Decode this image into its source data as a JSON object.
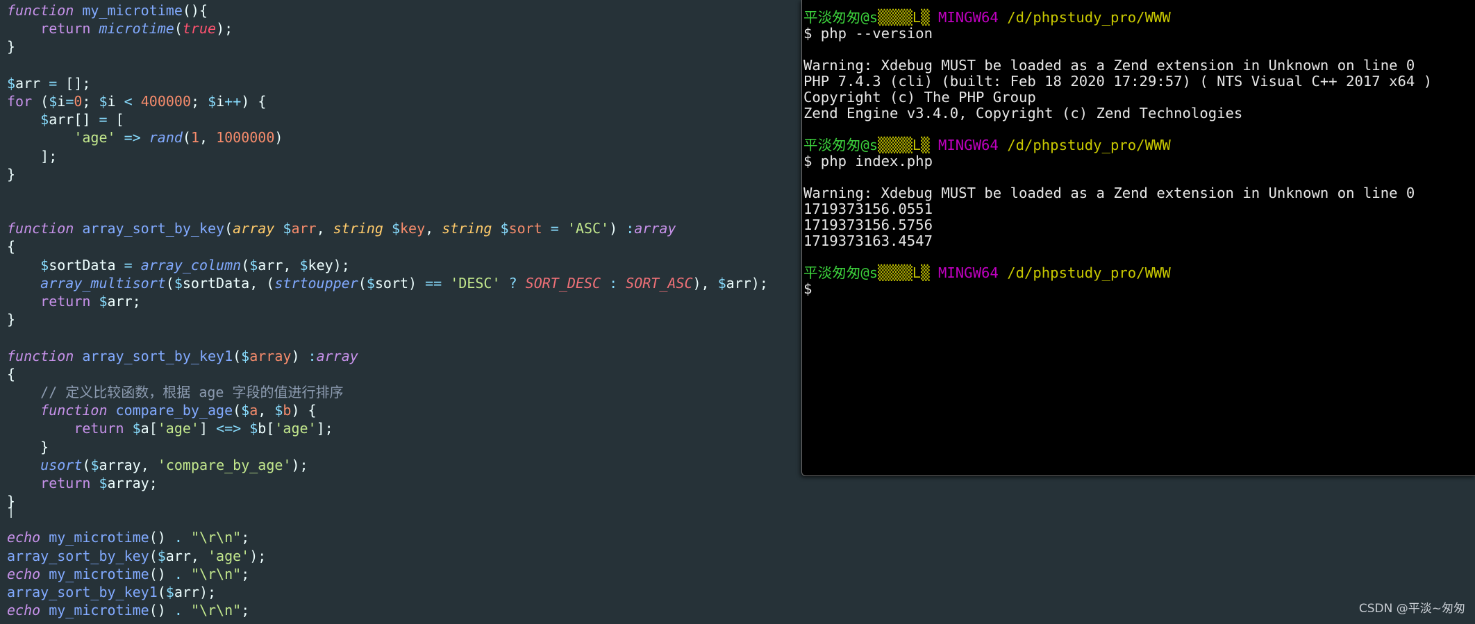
{
  "editor": {
    "lines": [
      [
        [
          "kw",
          "function"
        ],
        [
          "punct",
          " "
        ],
        [
          "fn",
          "my_microtime"
        ],
        [
          "punct",
          "(){"
        ]
      ],
      [
        [
          "punct",
          "    "
        ],
        [
          "kw-plain",
          "return"
        ],
        [
          "punct",
          " "
        ],
        [
          "fn-call",
          "microtime"
        ],
        [
          "punct",
          "("
        ],
        [
          "bool",
          "true"
        ],
        [
          "punct",
          ");"
        ]
      ],
      [
        [
          "punct",
          "}"
        ]
      ],
      [
        [
          "punct",
          ""
        ]
      ],
      [
        [
          "dollar",
          "$"
        ],
        [
          "var",
          "arr"
        ],
        [
          "punct",
          " "
        ],
        [
          "op",
          "="
        ],
        [
          "punct",
          " [];"
        ]
      ],
      [
        [
          "kw-plain",
          "for"
        ],
        [
          "punct",
          " ("
        ],
        [
          "dollar",
          "$"
        ],
        [
          "var",
          "i"
        ],
        [
          "op",
          "="
        ],
        [
          "num",
          "0"
        ],
        [
          "punct",
          "; "
        ],
        [
          "dollar",
          "$"
        ],
        [
          "var",
          "i"
        ],
        [
          "punct",
          " "
        ],
        [
          "op",
          "<"
        ],
        [
          "punct",
          " "
        ],
        [
          "num",
          "400000"
        ],
        [
          "punct",
          "; "
        ],
        [
          "dollar",
          "$"
        ],
        [
          "var",
          "i"
        ],
        [
          "op",
          "++"
        ],
        [
          "punct",
          ") {"
        ]
      ],
      [
        [
          "punct",
          "    "
        ],
        [
          "dollar",
          "$"
        ],
        [
          "var",
          "arr"
        ],
        [
          "punct",
          "[] "
        ],
        [
          "op",
          "="
        ],
        [
          "punct",
          " ["
        ]
      ],
      [
        [
          "punct",
          "        "
        ],
        [
          "str",
          "'age'"
        ],
        [
          "punct",
          " "
        ],
        [
          "op",
          "=>"
        ],
        [
          "punct",
          " "
        ],
        [
          "fn-call",
          "rand"
        ],
        [
          "punct",
          "("
        ],
        [
          "num",
          "1"
        ],
        [
          "punct",
          ", "
        ],
        [
          "num",
          "1000000"
        ],
        [
          "punct",
          ")"
        ]
      ],
      [
        [
          "punct",
          "    ];"
        ]
      ],
      [
        [
          "punct",
          "}"
        ]
      ],
      [
        [
          "punct",
          ""
        ]
      ],
      [
        [
          "punct",
          ""
        ]
      ],
      [
        [
          "kw",
          "function"
        ],
        [
          "punct",
          " "
        ],
        [
          "fn",
          "array_sort_by_key"
        ],
        [
          "punct",
          "("
        ],
        [
          "type",
          "array"
        ],
        [
          "punct",
          " "
        ],
        [
          "dollar",
          "$"
        ],
        [
          "var-param",
          "arr"
        ],
        [
          "punct",
          ", "
        ],
        [
          "type",
          "string"
        ],
        [
          "punct",
          " "
        ],
        [
          "dollar",
          "$"
        ],
        [
          "var-param",
          "key"
        ],
        [
          "punct",
          ", "
        ],
        [
          "type",
          "string"
        ],
        [
          "punct",
          " "
        ],
        [
          "dollar",
          "$"
        ],
        [
          "var-param",
          "sort"
        ],
        [
          "punct",
          " "
        ],
        [
          "op",
          "="
        ],
        [
          "punct",
          " "
        ],
        [
          "str",
          "'ASC'"
        ],
        [
          "punct",
          ") "
        ],
        [
          "op",
          ":"
        ],
        [
          "kw",
          "array"
        ]
      ],
      [
        [
          "punct",
          "{"
        ]
      ],
      [
        [
          "punct",
          "    "
        ],
        [
          "dollar",
          "$"
        ],
        [
          "var",
          "sortData"
        ],
        [
          "punct",
          " "
        ],
        [
          "op",
          "="
        ],
        [
          "punct",
          " "
        ],
        [
          "fn-call",
          "array_column"
        ],
        [
          "punct",
          "("
        ],
        [
          "dollar",
          "$"
        ],
        [
          "var",
          "arr"
        ],
        [
          "punct",
          ", "
        ],
        [
          "dollar",
          "$"
        ],
        [
          "var",
          "key"
        ],
        [
          "punct",
          ");"
        ]
      ],
      [
        [
          "punct",
          "    "
        ],
        [
          "fn-call",
          "array_multisort"
        ],
        [
          "punct",
          "("
        ],
        [
          "dollar",
          "$"
        ],
        [
          "var",
          "sortData"
        ],
        [
          "punct",
          ", ("
        ],
        [
          "fn-call",
          "strtoupper"
        ],
        [
          "punct",
          "("
        ],
        [
          "dollar",
          "$"
        ],
        [
          "var",
          "sort"
        ],
        [
          "punct",
          ") "
        ],
        [
          "op",
          "=="
        ],
        [
          "punct",
          " "
        ],
        [
          "str",
          "'DESC'"
        ],
        [
          "punct",
          " "
        ],
        [
          "op",
          "?"
        ],
        [
          "punct",
          " "
        ],
        [
          "const",
          "SORT_DESC"
        ],
        [
          "punct",
          " "
        ],
        [
          "op",
          ":"
        ],
        [
          "punct",
          " "
        ],
        [
          "const",
          "SORT_ASC"
        ],
        [
          "punct",
          "), "
        ],
        [
          "dollar",
          "$"
        ],
        [
          "var",
          "arr"
        ],
        [
          "punct",
          ");"
        ]
      ],
      [
        [
          "punct",
          "    "
        ],
        [
          "kw-plain",
          "return"
        ],
        [
          "punct",
          " "
        ],
        [
          "dollar",
          "$"
        ],
        [
          "var",
          "arr"
        ],
        [
          "punct",
          ";"
        ]
      ],
      [
        [
          "punct",
          "}"
        ]
      ],
      [
        [
          "punct",
          ""
        ]
      ],
      [
        [
          "kw",
          "function"
        ],
        [
          "punct",
          " "
        ],
        [
          "fn",
          "array_sort_by_key1"
        ],
        [
          "punct",
          "("
        ],
        [
          "dollar",
          "$"
        ],
        [
          "var-param",
          "array"
        ],
        [
          "punct",
          ") "
        ],
        [
          "op",
          ":"
        ],
        [
          "kw",
          "array"
        ]
      ],
      [
        [
          "punct",
          "{"
        ]
      ],
      [
        [
          "punct",
          "    "
        ],
        [
          "comment",
          "// 定义比较函数，根据 age 字段的值进行排序"
        ]
      ],
      [
        [
          "punct",
          "    "
        ],
        [
          "kw",
          "function"
        ],
        [
          "punct",
          " "
        ],
        [
          "fn",
          "compare_by_age"
        ],
        [
          "punct",
          "("
        ],
        [
          "dollar",
          "$"
        ],
        [
          "var-param",
          "a"
        ],
        [
          "punct",
          ", "
        ],
        [
          "dollar",
          "$"
        ],
        [
          "var-param",
          "b"
        ],
        [
          "punct",
          ") {"
        ]
      ],
      [
        [
          "punct",
          "        "
        ],
        [
          "kw-plain",
          "return"
        ],
        [
          "punct",
          " "
        ],
        [
          "dollar",
          "$"
        ],
        [
          "var",
          "a"
        ],
        [
          "punct",
          "["
        ],
        [
          "str",
          "'age'"
        ],
        [
          "punct",
          "] "
        ],
        [
          "op",
          "<=>"
        ],
        [
          "punct",
          " "
        ],
        [
          "dollar",
          "$"
        ],
        [
          "var",
          "b"
        ],
        [
          "punct",
          "["
        ],
        [
          "str",
          "'age'"
        ],
        [
          "punct",
          "];"
        ]
      ],
      [
        [
          "punct",
          "    }"
        ]
      ],
      [
        [
          "punct",
          "    "
        ],
        [
          "fn-call",
          "usort"
        ],
        [
          "punct",
          "("
        ],
        [
          "dollar",
          "$"
        ],
        [
          "var",
          "array"
        ],
        [
          "punct",
          ", "
        ],
        [
          "str",
          "'compare_by_age'"
        ],
        [
          "punct",
          ");"
        ]
      ],
      [
        [
          "punct",
          "    "
        ],
        [
          "kw-plain",
          "return"
        ],
        [
          "punct",
          " "
        ],
        [
          "dollar",
          "$"
        ],
        [
          "var",
          "array"
        ],
        [
          "punct",
          ";"
        ]
      ],
      [
        [
          "punct",
          "}"
        ]
      ],
      [
        [
          "punct",
          ""
        ]
      ],
      [
        [
          "kw",
          "echo"
        ],
        [
          "punct",
          " "
        ],
        [
          "fn",
          "my_microtime"
        ],
        [
          "punct",
          "() "
        ],
        [
          "op",
          "."
        ],
        [
          "punct",
          " "
        ],
        [
          "str",
          "\"\\r\\n\""
        ],
        [
          "punct",
          ";"
        ]
      ],
      [
        [
          "fn",
          "array_sort_by_key"
        ],
        [
          "punct",
          "("
        ],
        [
          "dollar",
          "$"
        ],
        [
          "var",
          "arr"
        ],
        [
          "punct",
          ", "
        ],
        [
          "str",
          "'age'"
        ],
        [
          "punct",
          ");"
        ]
      ],
      [
        [
          "kw",
          "echo"
        ],
        [
          "punct",
          " "
        ],
        [
          "fn",
          "my_microtime"
        ],
        [
          "punct",
          "() "
        ],
        [
          "op",
          "."
        ],
        [
          "punct",
          " "
        ],
        [
          "str",
          "\"\\r\\n\""
        ],
        [
          "punct",
          ";"
        ]
      ],
      [
        [
          "fn",
          "array_sort_by_key1"
        ],
        [
          "punct",
          "("
        ],
        [
          "dollar",
          "$"
        ],
        [
          "var",
          "arr"
        ],
        [
          "punct",
          ");"
        ]
      ],
      [
        [
          "kw",
          "echo"
        ],
        [
          "punct",
          " "
        ],
        [
          "fn",
          "my_microtime"
        ],
        [
          "punct",
          "() "
        ],
        [
          "op",
          "."
        ],
        [
          "punct",
          " "
        ],
        [
          "str",
          "\"\\r\\n\""
        ],
        [
          "punct",
          ";"
        ]
      ]
    ]
  },
  "terminal": {
    "lines": [
      [
        [
          "t-user",
          "平淡匆匆@s"
        ],
        [
          "t-host",
          "▒▒▒▒L▒"
        ],
        [
          "t-text",
          " "
        ],
        [
          "t-sys",
          "MINGW64"
        ],
        [
          "t-text",
          " "
        ],
        [
          "t-path",
          "/d/phpstudy_pro/WWW"
        ]
      ],
      [
        [
          "t-text",
          "$ php --version"
        ]
      ],
      [
        [
          "t-text",
          ""
        ]
      ],
      [
        [
          "t-text",
          "Warning: Xdebug MUST be loaded as a Zend extension in Unknown on line 0"
        ]
      ],
      [
        [
          "t-text",
          "PHP 7.4.3 (cli) (built: Feb 18 2020 17:29:57) ( NTS Visual C++ 2017 x64 )"
        ]
      ],
      [
        [
          "t-text",
          "Copyright (c) The PHP Group"
        ]
      ],
      [
        [
          "t-text",
          "Zend Engine v3.4.0, Copyright (c) Zend Technologies"
        ]
      ],
      [
        [
          "t-text",
          ""
        ]
      ],
      [
        [
          "t-user",
          "平淡匆匆@s"
        ],
        [
          "t-host",
          "▒▒▒▒L▒"
        ],
        [
          "t-text",
          " "
        ],
        [
          "t-sys",
          "MINGW64"
        ],
        [
          "t-text",
          " "
        ],
        [
          "t-path",
          "/d/phpstudy_pro/WWW"
        ]
      ],
      [
        [
          "t-text",
          "$ php index.php"
        ]
      ],
      [
        [
          "t-text",
          ""
        ]
      ],
      [
        [
          "t-text",
          "Warning: Xdebug MUST be loaded as a Zend extension in Unknown on line 0"
        ]
      ],
      [
        [
          "t-text",
          "1719373156.0551"
        ]
      ],
      [
        [
          "t-text",
          "1719373156.5756"
        ]
      ],
      [
        [
          "t-text",
          "1719373163.4547"
        ]
      ],
      [
        [
          "t-text",
          ""
        ]
      ],
      [
        [
          "t-user",
          "平淡匆匆@s"
        ],
        [
          "t-host",
          "▒▒▒▒L▒"
        ],
        [
          "t-text",
          " "
        ],
        [
          "t-sys",
          "MINGW64"
        ],
        [
          "t-text",
          " "
        ],
        [
          "t-path",
          "/d/phpstudy_pro/WWW"
        ]
      ],
      [
        [
          "t-text",
          "$"
        ]
      ]
    ]
  },
  "watermark": {
    "text": "CSDN @平淡~匆匆"
  },
  "colors": {
    "editor_bg": "#263238",
    "terminal_bg": "#000000",
    "keyword": "#c792ea",
    "function": "#82aaff",
    "string": "#c3e88d",
    "number": "#f78c6c",
    "prompt_user": "#3cd13c",
    "prompt_sys": "#bf00bf",
    "prompt_path": "#c8c800"
  }
}
